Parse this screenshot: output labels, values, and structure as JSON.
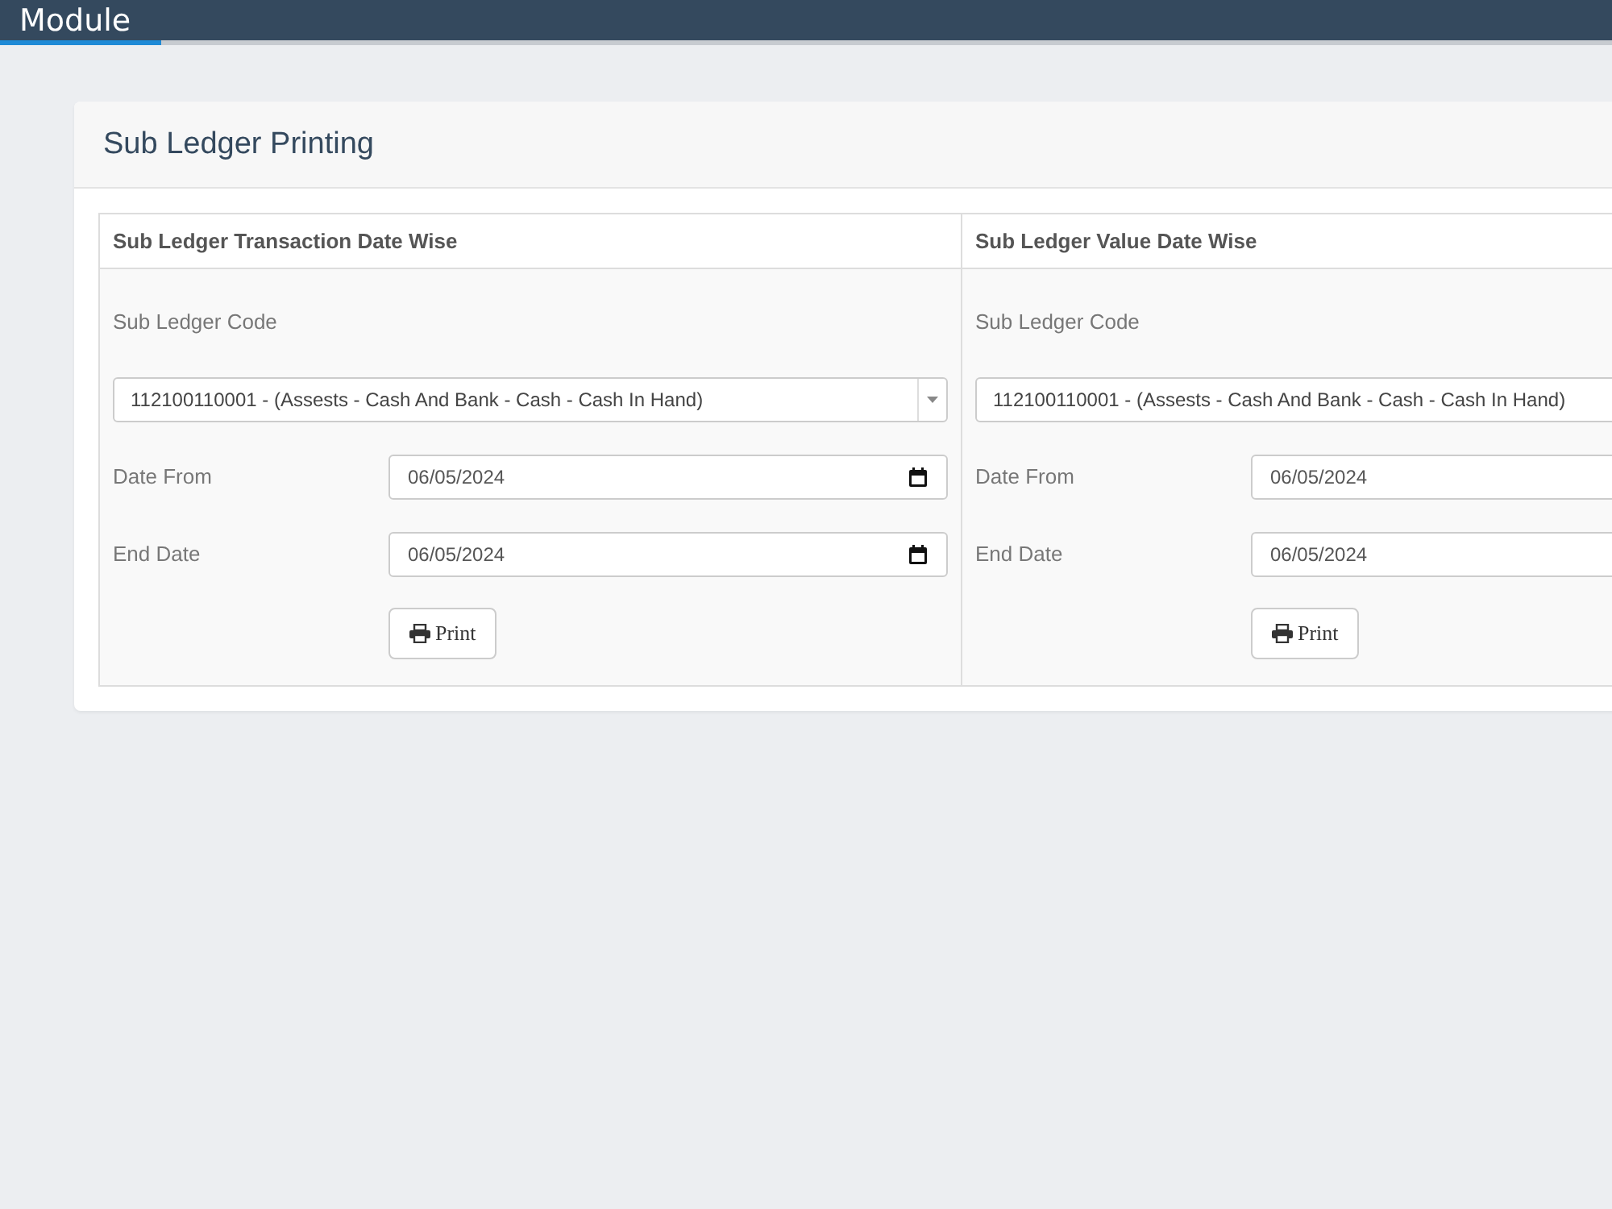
{
  "header": {
    "title": "Module",
    "progress": {
      "level": 0.1
    }
  },
  "card": {
    "title": "Sub Ledger Printing"
  },
  "panels": [
    {
      "title": "Sub Ledger Transaction Date Wise",
      "code_label": "Sub Ledger Code",
      "code_value": "112100110001 - (Assests - Cash And Bank - Cash - Cash In Hand)",
      "fields": [
        {
          "label": "Date From",
          "value": "06/05/2024"
        },
        {
          "label": "End Date",
          "value": "06/05/2024"
        }
      ],
      "button": "Print"
    },
    {
      "title": "Sub Ledger Value Date Wise",
      "code_label": "Sub Ledger Code",
      "code_value": "112100110001 - (Assests - Cash And Bank - Cash - Cash In Hand)",
      "fields": [
        {
          "label": "Date From",
          "value": "06/05/2024"
        },
        {
          "label": "End Date",
          "value": "06/05/2024"
        }
      ],
      "button": "Print"
    }
  ]
}
